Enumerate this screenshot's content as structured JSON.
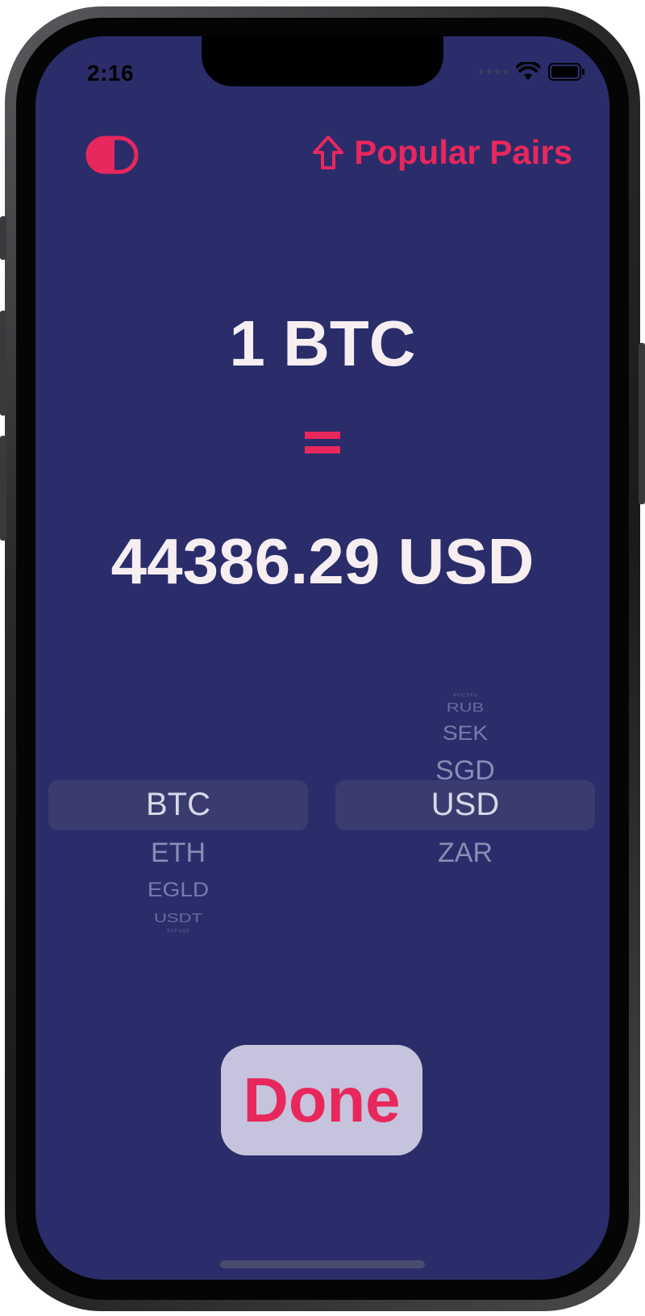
{
  "status_bar": {
    "time": "2:16",
    "icons": [
      "cellular-signal-icon",
      "wifi-icon",
      "battery-icon"
    ]
  },
  "header": {
    "theme_toggle_icon": "half-filled-toggle-icon",
    "popular_pairs_icon": "arrow-up-icon",
    "popular_pairs_label": "Popular Pairs"
  },
  "conversion": {
    "from_text": "1 BTC",
    "equals_symbol": "=",
    "to_text": "44386.29 USD"
  },
  "picker": {
    "from_column": {
      "selected": "BTC",
      "items_above": [],
      "items_below": [
        "ETH",
        "EGLD",
        "USDT",
        "BNB"
      ]
    },
    "to_column": {
      "selected": "USD",
      "items_above": [
        "RON",
        "RUB",
        "SEK",
        "SGD"
      ],
      "items_below": [
        "ZAR"
      ]
    }
  },
  "done_button": {
    "label": "Done"
  },
  "colors": {
    "background": "#2a2d6a",
    "accent": "#e8275d",
    "text_primary": "#f7eef2",
    "button_bg": "#c6c3dc"
  }
}
